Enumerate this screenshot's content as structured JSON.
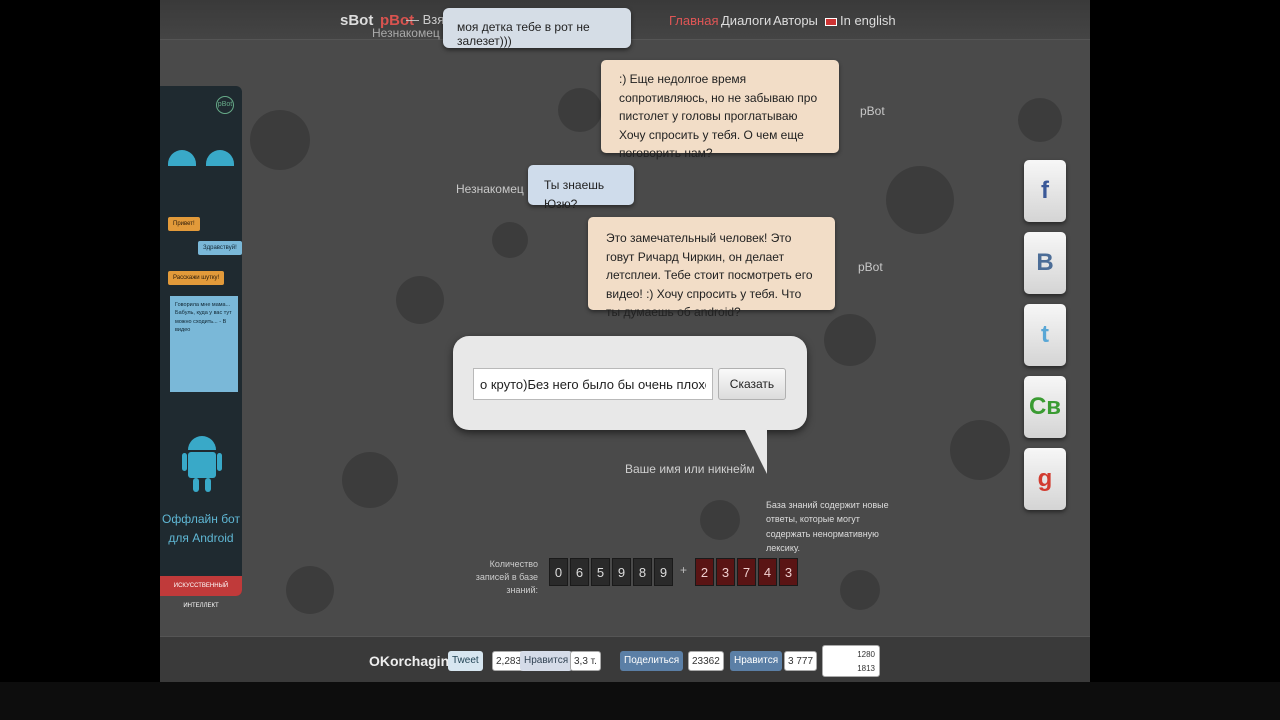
{
  "nav": {
    "logo_s": "sBot",
    "logo_p": "pBot",
    "slogan": "— Взять себе!",
    "items": [
      {
        "label": "Главная"
      },
      {
        "label": "Диалоги"
      },
      {
        "label": "Авторы"
      },
      {
        "label": "In english"
      }
    ]
  },
  "chat": {
    "top": {
      "speaker": "Незнакомец",
      "text": "моя детка тебе в рот не залезет)))"
    },
    "m1": {
      "speaker": "pBot",
      "text": ":) Еще недолгое время сопротивляюсь, но не забываю про пистолет у головы проглатываю Хочу спросить у тебя. О чем еще поговорить нам?"
    },
    "m2": {
      "speaker": "Незнакомец",
      "text": "Ты знаешь Юзю?"
    },
    "m3": {
      "speaker": "pBot",
      "text": "Это замечательный человек! Это говут Ричард Чиркин, он делает летсплеи. Тебе стоит посмотреть его видео! :) Хочу спросить у тебя. Что ты думаешь об android?"
    }
  },
  "input": {
    "value": "о круто)Без него было бы очень плохо)А ты",
    "button": "Сказать",
    "name_hint": "Ваше имя или никнейм"
  },
  "counter": {
    "label": "Количество записей в базе знаний:",
    "digits_a": [
      "0",
      "6",
      "5",
      "9",
      "8",
      "9"
    ],
    "plus": "+",
    "digits_b": [
      "2",
      "3",
      "7",
      "4",
      "3"
    ],
    "note": "База знаний содержит новые ответы, которые могут содержать ненормативную лексику."
  },
  "sidebar": {
    "logo": "pBot",
    "tag1": "Привет!",
    "tag2": "Здравствуй!",
    "tag3": "Расскажи шутку!",
    "chat": "Говорила мне мама...\nБабуль, куда у вас тут можно сходить...\n- В видео",
    "offline": "Оффлайн бот для Android",
    "footer": "ИСКУССТВЕННЫЙ ИНТЕЛЛЕКТ"
  },
  "social": [
    "f",
    "В",
    "t",
    "Св",
    "g"
  ],
  "footer": {
    "user": "OKorchagin",
    "tweet": "Tweet",
    "tweet_count": "2,283",
    "fb": "Нравится",
    "fb_count": "3,3 т.",
    "share": "Поделиться",
    "vk_count": "23362",
    "like": "Нравится",
    "like_count": "3 777",
    "stat1": "1280",
    "stat2": "1813"
  }
}
